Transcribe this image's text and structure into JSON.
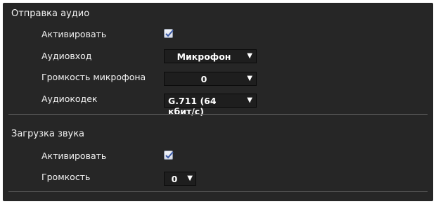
{
  "audio_send": {
    "title": "Отправка аудио",
    "enable_label": "Активировать",
    "enable_checked": true,
    "audio_input_label": "Аудиовход",
    "audio_input_value": "Микрофон",
    "mic_volume_label": "Громкость микрофона",
    "mic_volume_value": "0",
    "codec_label": "Аудиокодек",
    "codec_value": "G.711 (64 кбит/с)"
  },
  "audio_upload": {
    "title": "Загрузка звука",
    "enable_label": "Активировать",
    "enable_checked": true,
    "volume_label": "Громкость",
    "volume_value": "0"
  },
  "icons": {
    "checkmark": "checkmark-icon",
    "dropdown": "triangle-down-icon"
  }
}
